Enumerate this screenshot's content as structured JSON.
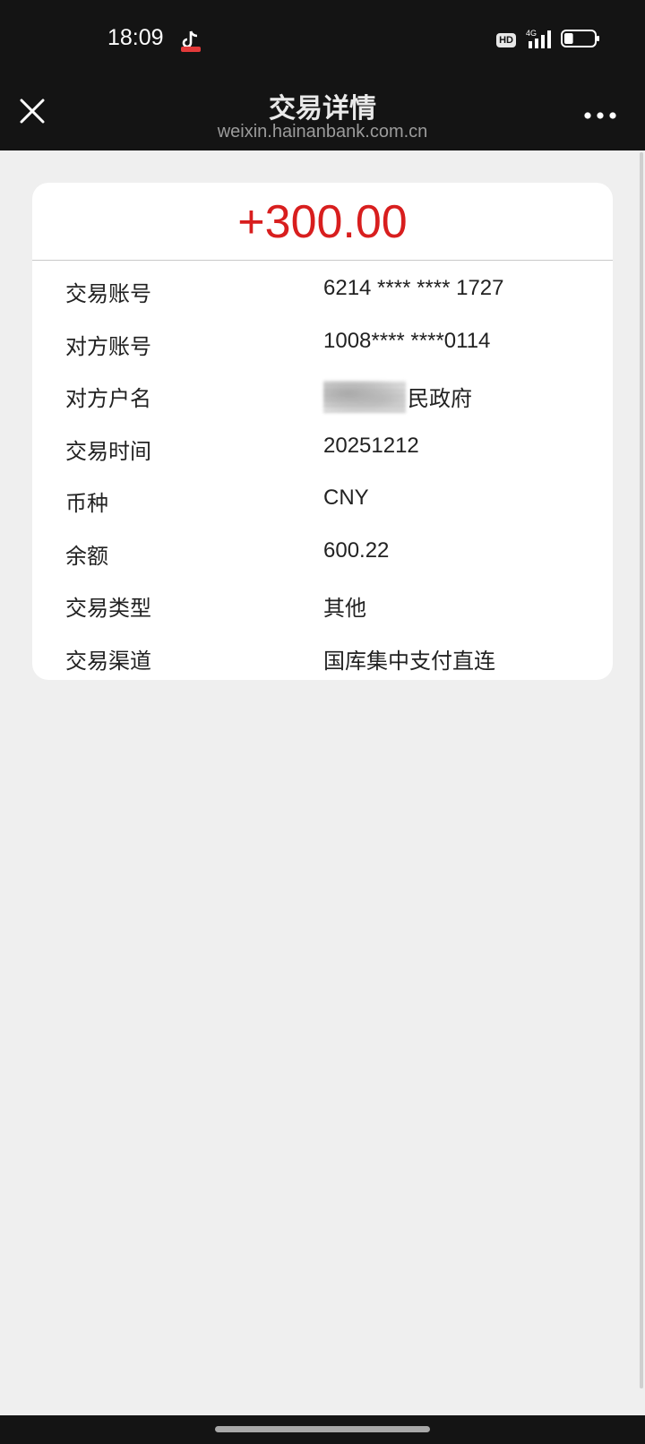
{
  "status_bar": {
    "time": "18:09",
    "app_icon": "tiktok-icon",
    "hd_label": "HD",
    "network_label": "4G",
    "signal_icon": "signal-bars-icon",
    "battery_icon": "battery-icon",
    "battery_level": 0.3
  },
  "nav": {
    "title": "交易详情",
    "url": "weixin.hainanbank.com.cn",
    "close_icon": "close-icon",
    "more_icon": "more-icon"
  },
  "transaction": {
    "amount": "+300.00",
    "amount_color": "#d81e1e",
    "rows": [
      {
        "label": "交易账号",
        "value": "6214 **** **** 1727"
      },
      {
        "label": "对方账号",
        "value": "1008**** ****0114"
      },
      {
        "label": "对方户名",
        "value": "民政府"
      },
      {
        "label": "交易时间",
        "value": "20251212"
      },
      {
        "label": "币种",
        "value": "CNY"
      },
      {
        "label": "余额",
        "value": "600.22"
      },
      {
        "label": "交易类型",
        "value": "其他"
      },
      {
        "label": "交易渠道",
        "value": "国库集中支付直连"
      }
    ]
  }
}
